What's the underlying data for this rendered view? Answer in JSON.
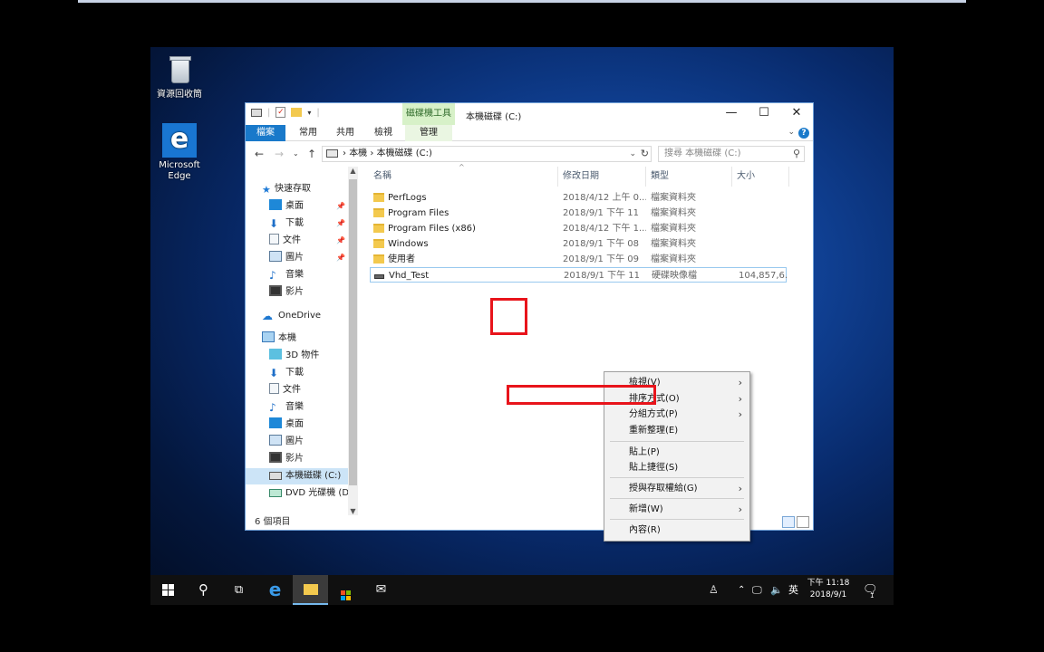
{
  "desktop": {
    "recycle_bin_label": "資源回收筒",
    "edge_label_line1": "Microsoft",
    "edge_label_line2": "Edge"
  },
  "window": {
    "tool_tab": "磁碟機工具",
    "title": "本機磁碟 (C:)",
    "minimize": "—",
    "maximize": "☐",
    "close": "✕"
  },
  "ribbon": {
    "tabs": [
      "檔案",
      "常用",
      "共用",
      "檢視",
      "管理"
    ]
  },
  "address": {
    "segments": [
      "本機",
      "本機磁碟 (C:)"
    ],
    "search_placeholder": "搜尋 本機磁碟 (C:)"
  },
  "nav_pane": {
    "quick_access": "快速存取",
    "quick_items": [
      "桌面",
      "下載",
      "文件",
      "圖片",
      "音樂",
      "影片"
    ],
    "onedrive": "OneDrive",
    "this_pc": "本機",
    "pc_items": [
      "3D 物件",
      "下載",
      "文件",
      "音樂",
      "桌面",
      "圖片",
      "影片",
      "本機磁碟 (C:)",
      "DVD 光碟機 (D:)"
    ]
  },
  "columns": {
    "name": "名稱",
    "date": "修改日期",
    "type": "類型",
    "size": "大小"
  },
  "files": [
    {
      "name": "PerfLogs",
      "date": "2018/4/12 上午 0...",
      "type": "檔案資料夾",
      "size": ""
    },
    {
      "name": "Program Files",
      "date": "2018/9/1 下午 11",
      "type": "檔案資料夾",
      "size": ""
    },
    {
      "name": "Program Files (x86)",
      "date": "2018/4/12 下午 1...",
      "type": "檔案資料夾",
      "size": ""
    },
    {
      "name": "Windows",
      "date": "2018/9/1 下午 08",
      "type": "檔案資料夾",
      "size": ""
    },
    {
      "name": "使用者",
      "date": "2018/9/1 下午 09",
      "type": "檔案資料夾",
      "size": ""
    },
    {
      "name": "Vhd_Test",
      "date": "2018/9/1 下午 11",
      "type": "硬碟映像檔",
      "size": "104,857,6..."
    }
  ],
  "status": {
    "item_count": "6 個項目"
  },
  "context_menu": {
    "view": "檢視(V)",
    "sort_by": "排序方式(O)",
    "group_by": "分組方式(P)",
    "refresh": "重新整理(E)",
    "paste": "貼上(P)",
    "paste_shortcut": "貼上捷徑(S)",
    "give_access": "授與存取權給(G)",
    "new": "新增(W)",
    "properties": "內容(R)"
  },
  "taskbar": {
    "ime": "英",
    "time": "下午 11:18",
    "date": "2018/9/1",
    "notification_count": "1"
  },
  "colors": {
    "highlight": "#e8141b",
    "accent": "#1979ca",
    "tool_tab": "#d7f1c8"
  }
}
